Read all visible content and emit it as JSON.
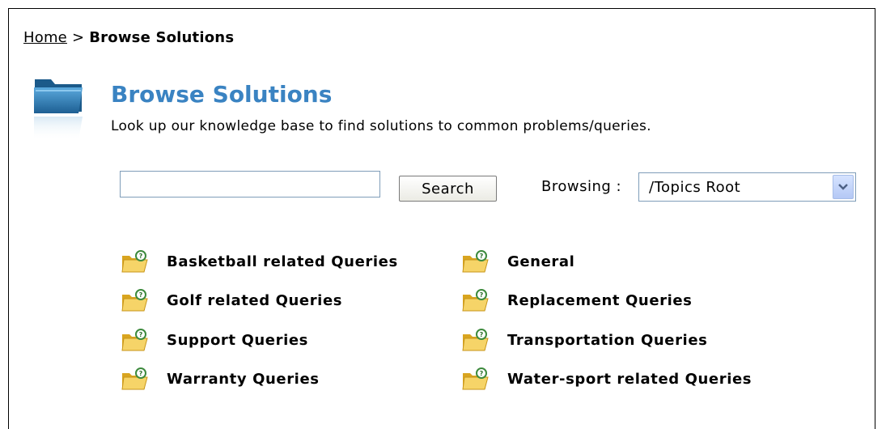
{
  "breadcrumb": {
    "home": "Home",
    "separator": ">",
    "current": "Browse Solutions"
  },
  "header": {
    "title": "Browse Solutions",
    "subtitle": "Look up our knowledge base to find solutions to common problems/queries."
  },
  "search": {
    "value": "",
    "button_label": "Search"
  },
  "browsing": {
    "label": "Browsing :",
    "selected": "/Topics Root"
  },
  "topics": [
    "Basketball related Queries",
    "General",
    "Golf related Queries",
    "Replacement Queries",
    "Support Queries",
    "Transportation Queries",
    "Warranty Queries",
    "Water-sport related Queries"
  ],
  "colors": {
    "title": "#3a83c2",
    "folder": "#f2c94c",
    "folder_blue": "#2e7fb8"
  }
}
